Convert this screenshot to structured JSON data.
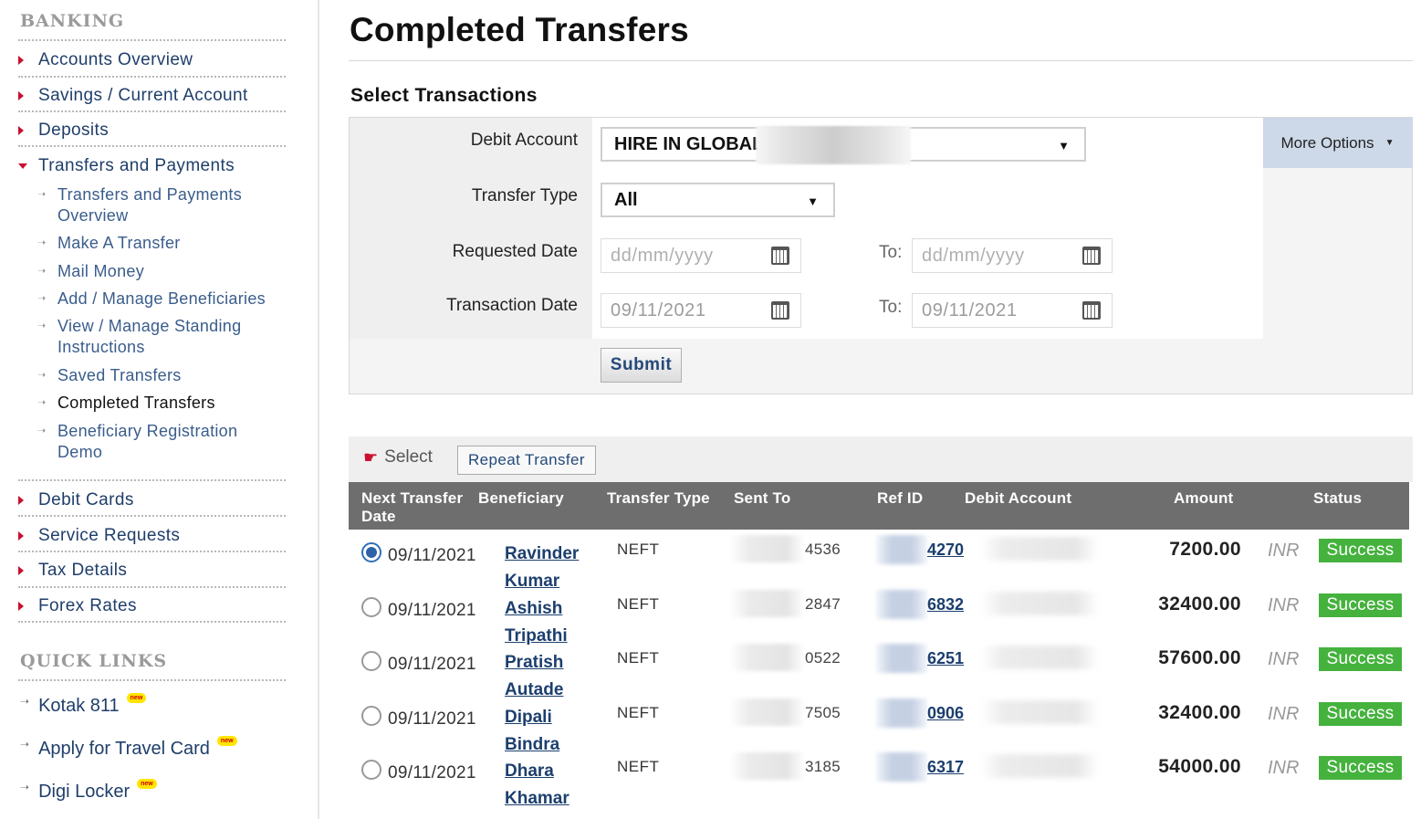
{
  "sidebar": {
    "banking_heading": "BANKING",
    "items": [
      {
        "label": "Accounts Overview"
      },
      {
        "label": "Savings / Current Account"
      },
      {
        "label": "Deposits"
      },
      {
        "label": "Transfers and Payments"
      },
      {
        "label": "Debit Cards"
      },
      {
        "label": "Service Requests"
      },
      {
        "label": "Tax Details"
      },
      {
        "label": "Forex Rates"
      }
    ],
    "sub_items": [
      {
        "label": "Transfers and Payments Overview"
      },
      {
        "label": "Make A Transfer"
      },
      {
        "label": "Mail Money"
      },
      {
        "label": "Add / Manage Beneficiaries"
      },
      {
        "label": "View / Manage Standing Instructions"
      },
      {
        "label": "Saved Transfers"
      },
      {
        "label": "Completed Transfers"
      },
      {
        "label": "Beneficiary Registration Demo"
      }
    ],
    "quick_links_heading": "QUICK LINKS",
    "quick_links": [
      {
        "label": "Kotak 811",
        "badge": "new"
      },
      {
        "label": "Apply for Travel Card",
        "badge": "new"
      },
      {
        "label": "Digi Locker",
        "badge": "new"
      }
    ]
  },
  "main": {
    "title": "Completed Transfers",
    "section_title": "Select Transactions",
    "more_options": "More Options",
    "filters": {
      "debit_account_label": "Debit Account",
      "debit_account_value": "HIRE IN GLOBAL",
      "transfer_type_label": "Transfer Type",
      "transfer_type_value": "All",
      "requested_date_label": "Requested Date",
      "requested_from_placeholder": "dd/mm/yyyy",
      "requested_to_placeholder": "dd/mm/yyyy",
      "transaction_date_label": "Transaction Date",
      "transaction_from": "09/11/2021",
      "transaction_to": "09/11/2021",
      "to_label": "To:",
      "submit": "Submit"
    },
    "actions": {
      "select_label": "Select",
      "repeat_transfer": "Repeat Transfer"
    },
    "table": {
      "headers": {
        "next_transfer_date": "Next Transfer Date",
        "beneficiary": "Beneficiary",
        "transfer_type": "Transfer Type",
        "sent_to": "Sent To",
        "ref_id": "Ref ID",
        "debit_account": "Debit Account",
        "amount": "Amount",
        "status": "Status"
      },
      "rows": [
        {
          "date": "09/11/2021",
          "beneficiary": "Ravinder Kumar",
          "type": "NEFT",
          "sent_to": "4536",
          "ref_id": "4270",
          "amount": "7200.00",
          "currency": "INR",
          "status": "Success",
          "selected": true
        },
        {
          "date": "09/11/2021",
          "beneficiary": "Ashish Tripathi",
          "type": "NEFT",
          "sent_to": "2847",
          "ref_id": "6832",
          "amount": "32400.00",
          "currency": "INR",
          "status": "Success",
          "selected": false
        },
        {
          "date": "09/11/2021",
          "beneficiary": "Pratish Autade",
          "type": "NEFT",
          "sent_to": "0522",
          "ref_id": "6251",
          "amount": "57600.00",
          "currency": "INR",
          "status": "Success",
          "selected": false
        },
        {
          "date": "09/11/2021",
          "beneficiary": "Dipali Bindra",
          "type": "NEFT",
          "sent_to": "7505",
          "ref_id": "0906",
          "amount": "32400.00",
          "currency": "INR",
          "status": "Success",
          "selected": false
        },
        {
          "date": "09/11/2021",
          "beneficiary": "Dhara Khamar",
          "type": "NEFT",
          "sent_to": "3185",
          "ref_id": "6317",
          "amount": "54000.00",
          "currency": "INR",
          "status": "Success",
          "selected": false
        }
      ]
    }
  },
  "colors": {
    "accent_red": "#c8102e",
    "link_blue": "#1c3f6e",
    "status_green": "#45b23e",
    "header_gray": "#6e6e6e",
    "more_options_bg": "#cdd9e9"
  }
}
